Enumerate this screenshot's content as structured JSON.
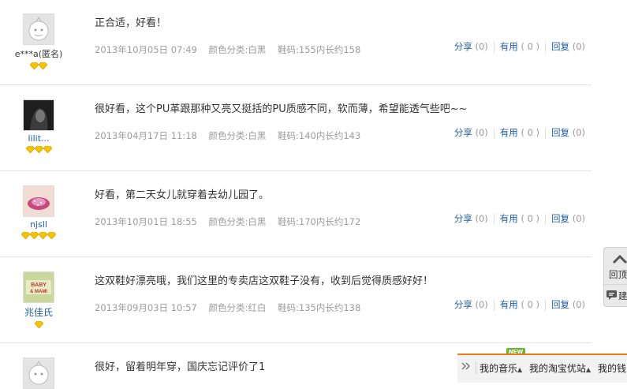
{
  "reviews": [
    {
      "user": "e***a(匿名)",
      "user_is_link": false,
      "avatar": "default-face-avatar",
      "gems": 2,
      "text": "正合适，好看！",
      "date": "2013年10月05日 07:49",
      "color": "颜色分类:白黑",
      "size": "鞋码:155内长约158",
      "share_label": "分享",
      "share_count": "(0)",
      "useful_label": "有用",
      "useful_count": "( 0 )",
      "reply_label": "回复",
      "reply_count": "(0)"
    },
    {
      "user": "lilit...",
      "user_is_link": true,
      "avatar": "dark-portrait-avatar",
      "gems": 3,
      "text": "很好看，这个PU革跟那种又亮又挺括的PU质感不同，软而薄，希望能透气些吧~~",
      "date": "2013年04月17日 11:18",
      "color": "颜色分类:白黑",
      "size": "鞋码:140内长约143",
      "share_label": "分享",
      "share_count": "(0)",
      "useful_label": "有用",
      "useful_count": "( 0 )",
      "reply_label": "回复",
      "reply_count": "(0)"
    },
    {
      "user": "njsll",
      "user_is_link": true,
      "avatar": "sparkle-lips-avatar",
      "gems": 4,
      "text": "好看，第二天女儿就穿着去幼儿园了。",
      "date": "2013年10月01日 18:55",
      "color": "颜色分类:白黑",
      "size": "鞋码:170内长约172",
      "share_label": "分享",
      "share_count": "(0)",
      "useful_label": "有用",
      "useful_count": "( 0 )",
      "reply_label": "回复",
      "reply_count": "(0)"
    },
    {
      "user": "兆佳氏",
      "user_is_link": true,
      "avatar": "baby-mami-avatar",
      "avatar_text": [
        "BABY",
        "& MAMI"
      ],
      "gems": 1,
      "text": "这双鞋好漂亮哦，我们这里的专卖店这双鞋子没有，收到后觉得质感好好！",
      "date": "2013年09月03日 10:57",
      "color": "颜色分类:红白",
      "size": "鞋码:135内长约138",
      "share_label": "分享",
      "share_count": "(0)",
      "useful_label": "有用",
      "useful_count": "( 0 )",
      "reply_label": "回复",
      "reply_count": "(0)"
    },
    {
      "avatar": "default-face-avatar",
      "text": "很好，留着明年穿，国庆忘记评价了1"
    }
  ],
  "float_panel": {
    "top_label": "回顶",
    "top_icon": "chevron-up-icon",
    "bottom_label": "建",
    "bottom_icon": "chat-bubble-icon"
  },
  "toolbar": {
    "badge": "NEW",
    "items": [
      "我的音乐",
      "我的淘宝优站",
      "我的钱"
    ],
    "expand_icon": "double-chevron-icon"
  },
  "colors": {
    "link": "#1f5fa8",
    "meta": "#9c9c9c",
    "gem": "#f5c400",
    "toolbar_accent": "#f07b17",
    "badge": "#6ab531"
  }
}
